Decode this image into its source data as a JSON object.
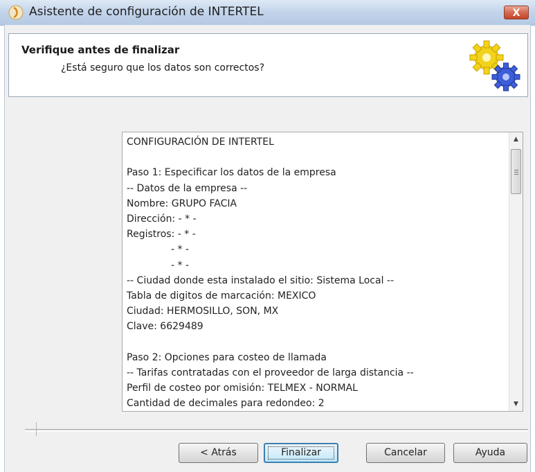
{
  "window": {
    "title": "Asistente de configuración de INTERTEL",
    "close_label": "X"
  },
  "header": {
    "title": "Verifique antes de finalizar",
    "subtitle": "¿Está seguro que los datos son correctos?"
  },
  "summary": {
    "lines": [
      {
        "text": "CONFIGURACIÓN DE INTERTEL",
        "indent": false
      },
      {
        "text": "",
        "indent": false
      },
      {
        "text": "Paso 1: Especificar los datos de la empresa",
        "indent": false
      },
      {
        "text": "-- Datos de la empresa --",
        "indent": false
      },
      {
        "text": "Nombre: GRUPO FACIA",
        "indent": false
      },
      {
        "text": "Dirección: - * -",
        "indent": false
      },
      {
        "text": "Registros: - * -",
        "indent": false
      },
      {
        "text": "- * -",
        "indent": true
      },
      {
        "text": "- * -",
        "indent": true
      },
      {
        "text": "-- Ciudad donde esta instalado el sitio: Sistema Local --",
        "indent": false
      },
      {
        "text": "Tabla de digitos de marcación: MEXICO",
        "indent": false
      },
      {
        "text": "Ciudad: HERMOSILLO, SON, MX",
        "indent": false
      },
      {
        "text": "Clave: 6629489",
        "indent": false
      },
      {
        "text": "",
        "indent": false
      },
      {
        "text": "Paso 2: Opciones para costeo de llamada",
        "indent": false
      },
      {
        "text": "-- Tarifas contratadas con el proveedor de larga distancia --",
        "indent": false
      },
      {
        "text": "Perfil de costeo por omisión: TELMEX - NORMAL",
        "indent": false
      },
      {
        "text": "Cantidad de decimales para redondeo: 2",
        "indent": false
      }
    ],
    "scroll_position": 0.05
  },
  "buttons": {
    "back": "< Atrás",
    "finish": "Finalizar",
    "cancel": "Cancelar",
    "help": "Ayuda"
  },
  "icons": {
    "app": "intertel-logo-icon",
    "gears": "gears-icon",
    "close": "close-icon"
  }
}
